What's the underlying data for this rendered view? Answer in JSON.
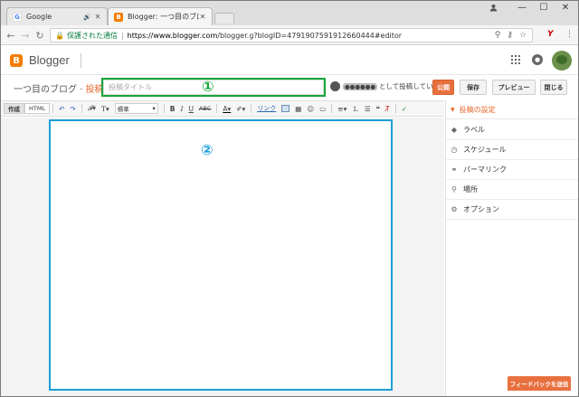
{
  "browser": {
    "tabs": [
      {
        "title": "Google",
        "favicon_letter": "G",
        "favicon_color": "#4285f4",
        "audio": "🔊"
      },
      {
        "title": "Blogger: 一つ目のブログ・",
        "favicon_letter": "B",
        "favicon_color": "#f57d00"
      }
    ],
    "address": {
      "secure_label": "保護された通信",
      "url_domain": "https://www.blogger.com",
      "url_path": "/blogger.g?blogID=4791907591912660444#editor"
    }
  },
  "app": {
    "name": "Blogger",
    "brand_color": "#f57d00"
  },
  "editor_header": {
    "blog_name": "一つ目のブログ",
    "separator": "·",
    "section": "投稿",
    "title_placeholder": "投稿タイトル",
    "author_suffix": "として投稿しています",
    "publish": "公開",
    "save": "保存",
    "preview": "プレビュー",
    "close": "閉じる"
  },
  "toolbar": {
    "compose": "作成",
    "html": "HTML",
    "font_size": "標準",
    "link": "リンク"
  },
  "markers": {
    "one": "①",
    "two": "②"
  },
  "sidebar": {
    "heading": "投稿の設定",
    "items": [
      {
        "label": "ラベル",
        "icon": "tag-icon",
        "glyph": "◆"
      },
      {
        "label": "スケジュール",
        "icon": "clock-icon",
        "glyph": "◷"
      },
      {
        "label": "パーマリンク",
        "icon": "link-icon",
        "glyph": "⚭"
      },
      {
        "label": "場所",
        "icon": "location-pin-icon",
        "glyph": "⚲"
      },
      {
        "label": "オプション",
        "icon": "gear-icon",
        "glyph": "⚙"
      }
    ]
  },
  "feedback": "フィードバックを送信"
}
